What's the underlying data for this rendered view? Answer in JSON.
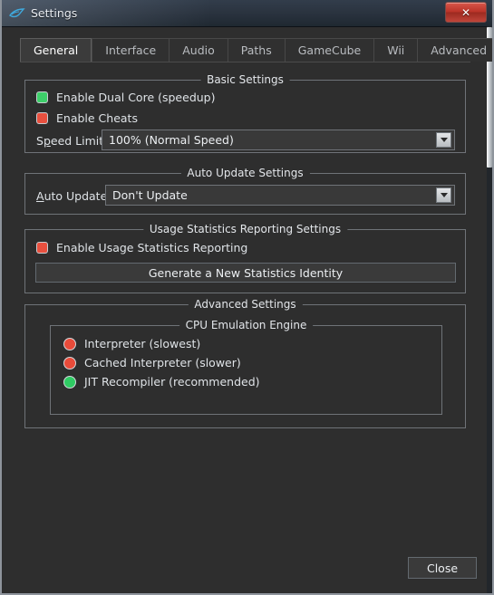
{
  "window": {
    "title": "Settings",
    "icon": "dolphin-icon",
    "close_label": "✕",
    "accent_close": "#bb3328",
    "background": "#2e2e2e"
  },
  "tabs": [
    {
      "label": "General",
      "active": true
    },
    {
      "label": "Interface",
      "active": false
    },
    {
      "label": "Audio",
      "active": false
    },
    {
      "label": "Paths",
      "active": false
    },
    {
      "label": "GameCube",
      "active": false
    },
    {
      "label": "Wii",
      "active": false
    },
    {
      "label": "Advanced",
      "active": false
    }
  ],
  "basic_settings": {
    "title": "Basic Settings",
    "checkboxes": [
      {
        "label": "Enable Dual Core (speedup)",
        "checked": true,
        "color": "#3ecf6a"
      },
      {
        "label": "Enable Cheats",
        "checked": false,
        "color": "#e8503f"
      }
    ],
    "speed_limit": {
      "label_pre": "S",
      "label_acc": "p",
      "label_post": "eed Limit:",
      "value": "100% (Normal Speed)"
    }
  },
  "auto_update_settings": {
    "title": "Auto Update Settings",
    "auto_update": {
      "label_pre": "",
      "label_acc": "A",
      "label_post": "uto Update:",
      "value": "Don't Update"
    }
  },
  "usage_statistics_settings": {
    "title": "Usage Statistics Reporting Settings",
    "checkbox": {
      "label": "Enable Usage Statistics Reporting",
      "checked": false,
      "color": "#e8503f"
    },
    "generate_button": "Generate a New Statistics Identity"
  },
  "advanced_settings": {
    "title": "Advanced Settings",
    "cpu_engine": {
      "title": "CPU Emulation Engine",
      "options": [
        {
          "label": "Interpreter (slowest)",
          "selected": false,
          "color": "#e84b3a"
        },
        {
          "label": "Cached Interpreter (slower)",
          "selected": false,
          "color": "#e84b3a"
        },
        {
          "label": "JIT Recompiler (recommended)",
          "selected": true,
          "color": "#2fcb63"
        }
      ]
    }
  },
  "footer": {
    "close_label": "Close"
  }
}
